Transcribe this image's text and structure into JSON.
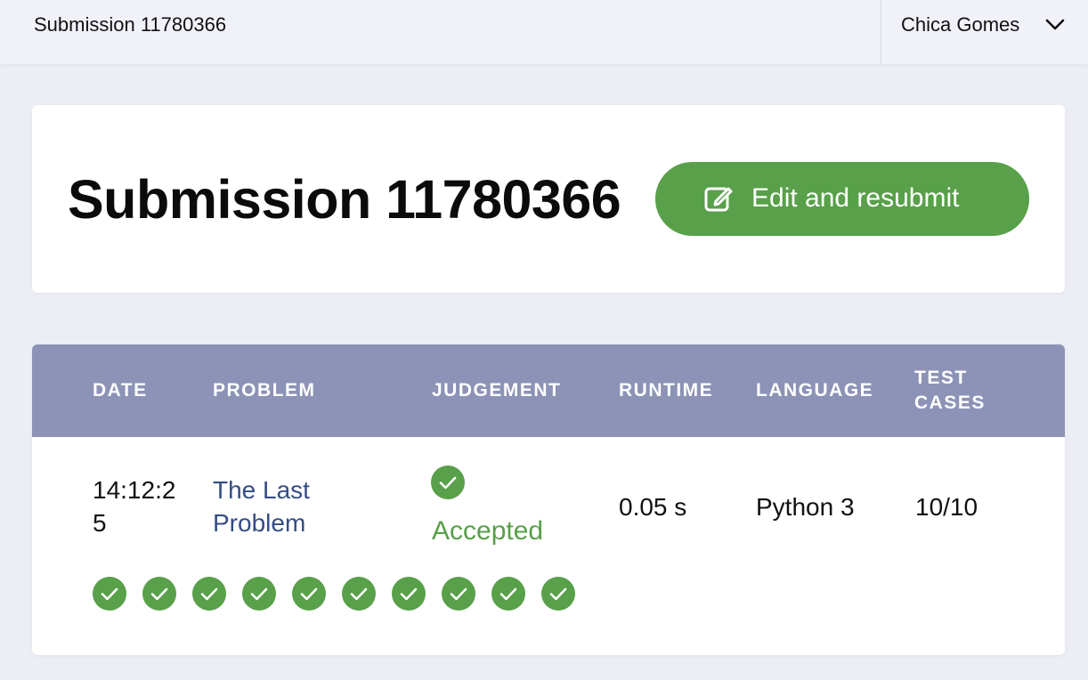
{
  "topbar": {
    "title": "Submission 11780366",
    "user_name": "Chica Gomes",
    "user_menu_icon": "chevron-down-icon"
  },
  "header": {
    "title": "Submission 11780366",
    "resubmit_label": "Edit and resubmit",
    "resubmit_icon": "edit-icon"
  },
  "table": {
    "columns": {
      "date": "DATE",
      "problem": "PROBLEM",
      "judgement": "JUDGEMENT",
      "runtime": "RUNTIME",
      "language": "LANGUAGE",
      "test_cases_line1": "TEST",
      "test_cases_line2": "CASES"
    },
    "row": {
      "date_line1": "14:12:2",
      "date_line2": "5",
      "problem_line1": "The Last",
      "problem_line2": "Problem",
      "judgement": "Accepted",
      "runtime": "0.05 s",
      "language": "Python 3",
      "test_cases": "10/10"
    },
    "test_results": [
      "passed",
      "passed",
      "passed",
      "passed",
      "passed",
      "passed",
      "passed",
      "passed",
      "passed",
      "passed"
    ]
  },
  "colors": {
    "accent_green": "#58a049",
    "header_bg": "#8c93b6",
    "link": "#354d85",
    "page_bg": "#ecedf5"
  }
}
